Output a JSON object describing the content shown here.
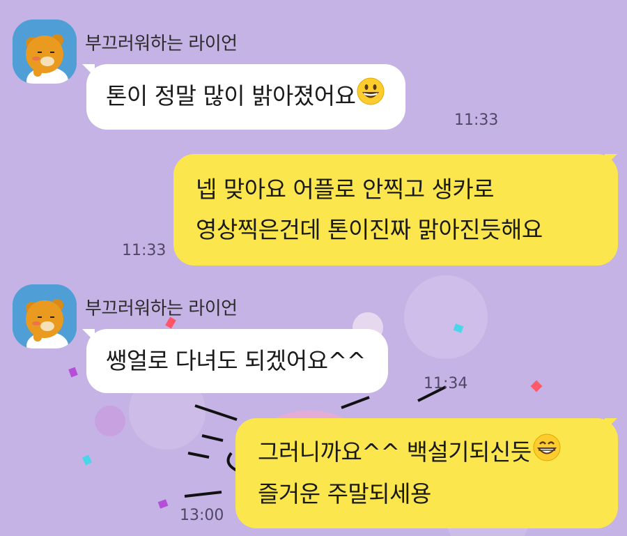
{
  "messages": [
    {
      "sender": "부끄러워하는 라이언",
      "text": "톤이 정말 많이 밝아졌어요",
      "emoji": "grinning-face-emoji",
      "time": "11:33"
    },
    {
      "text_line1": "넵 맞아요 어플로 안찍고 생카로",
      "text_line2": "영상찍은건데 톤이진짜 맑아진듯해요",
      "time": "11:33"
    },
    {
      "sender": "부끄러워하는 라이언",
      "text": "쌩얼로 다녀도 되겠어요^^",
      "time": "11:34"
    },
    {
      "text_line1": "그러니까요^^ 백설기되신듯",
      "emoji": "beaming-face-emoji",
      "text_line2": "즐거운 주말되세용",
      "time": "13:00"
    }
  ],
  "colors": {
    "background": "#c6b3e6",
    "incoming_bubble": "#ffffff",
    "outgoing_bubble": "#fbe64d",
    "avatar_bg": "#4f9fd6"
  }
}
